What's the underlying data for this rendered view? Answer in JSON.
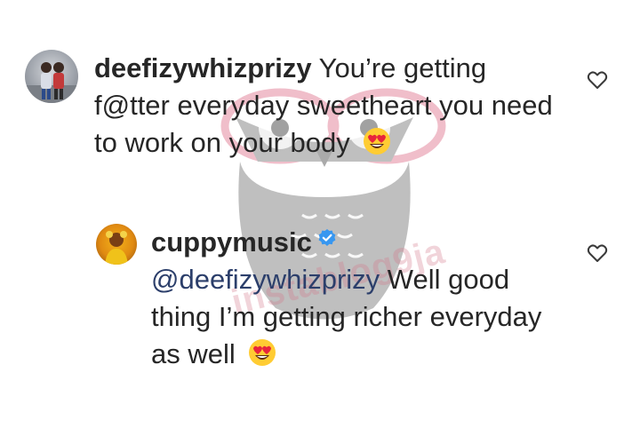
{
  "comments": [
    {
      "username": "deefizywhizprizy",
      "text": " You’re getting f@tter everyday sweetheart you need to work on your body",
      "emoji": "heart-eyes-emoji",
      "like_icon": "heart-outline-icon"
    }
  ],
  "reply": {
    "username": "cuppymusic",
    "verified": true,
    "mention": "@deefizywhizprizy",
    "text": " Well good thing I’m getting richer everyday as well",
    "emoji": "heart-eyes-emoji",
    "like_icon": "heart-outline-icon"
  },
  "watermark": {
    "logo": "owl-watermark",
    "text": "instablog9ja"
  },
  "colors": {
    "text": "#262626",
    "mention": "#2c3f6b",
    "verified": "#3897f0",
    "watermark_gray": "#8c8c8c",
    "watermark_pink": "#e48aa0"
  }
}
